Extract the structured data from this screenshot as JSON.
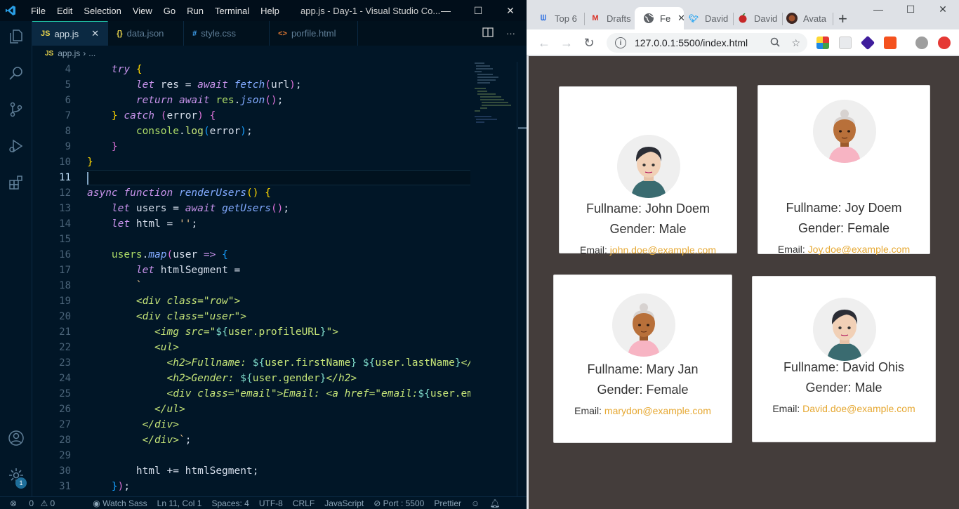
{
  "vscode": {
    "window_title": "app.js - Day-1 - Visual Studio Co...",
    "menu": [
      "File",
      "Edit",
      "Selection",
      "View",
      "Go",
      "Run",
      "Terminal",
      "Help"
    ],
    "tabs": [
      {
        "icon": "JS",
        "label": "app.js",
        "active": true
      },
      {
        "icon": "{}",
        "label": "data.json",
        "active": false
      },
      {
        "icon": "#",
        "label": "style.css",
        "active": false
      },
      {
        "icon": "<>",
        "label": "porfile.html",
        "active": false
      }
    ],
    "breadcrumb": {
      "file": "app.js",
      "rest": "..."
    },
    "line_numbers": [
      "4",
      "5",
      "6",
      "7",
      "8",
      "9",
      "10",
      "11",
      "12",
      "13",
      "14",
      "15",
      "16",
      "17",
      "18",
      "19",
      "20",
      "21",
      "22",
      "23",
      "24",
      "25",
      "26",
      "27",
      "28",
      "29",
      "30",
      "31"
    ],
    "current_line": "11",
    "status": {
      "errors": "0",
      "warnings": "0",
      "watch_sass": "Watch Sass",
      "position": "Ln 11, Col 1",
      "spaces": "Spaces: 4",
      "encoding": "UTF-8",
      "eol": "CRLF",
      "language": "JavaScript",
      "port": "Port : 5500",
      "prettier": "Prettier"
    },
    "notification_count": "1"
  },
  "chrome": {
    "tabs": [
      {
        "title": "Top 6",
        "icon": "wavy-logo-icon"
      },
      {
        "title": "Drafts",
        "icon": "gmail-icon"
      },
      {
        "title": "Fe",
        "icon": "globe-icon",
        "active": true
      },
      {
        "title": "David",
        "icon": "twitter-icon"
      },
      {
        "title": "David",
        "icon": "cherry-icon"
      },
      {
        "title": "Avata",
        "icon": "avatar-icon"
      }
    ],
    "url": "127.0.0.1:5500/index.html",
    "page": {
      "users": [
        {
          "fullname": "Fullname: John Doem",
          "gender": "Gender: Male",
          "email_label": "Email:",
          "email": "john.doe@example.com",
          "avatar": "male-avatar"
        },
        {
          "fullname": "Fullname: Joy Doem",
          "gender": "Gender: Female",
          "email_label": "Email:",
          "email": "Joy.doe@example.com",
          "avatar": "female-avatar"
        },
        {
          "fullname": "Fullname: Mary Jan",
          "gender": "Gender: Female",
          "email_label": "Email:",
          "email": "marydon@example.com",
          "avatar": "female-avatar"
        },
        {
          "fullname": "Fullname: David Ohis",
          "gender": "Gender: Male",
          "email_label": "Email:",
          "email": "David.doe@example.com",
          "avatar": "male-avatar"
        }
      ]
    }
  },
  "colors": {
    "editor_bg": "#011627",
    "page_bg": "#443d3b",
    "email_link": "#e6a832"
  }
}
